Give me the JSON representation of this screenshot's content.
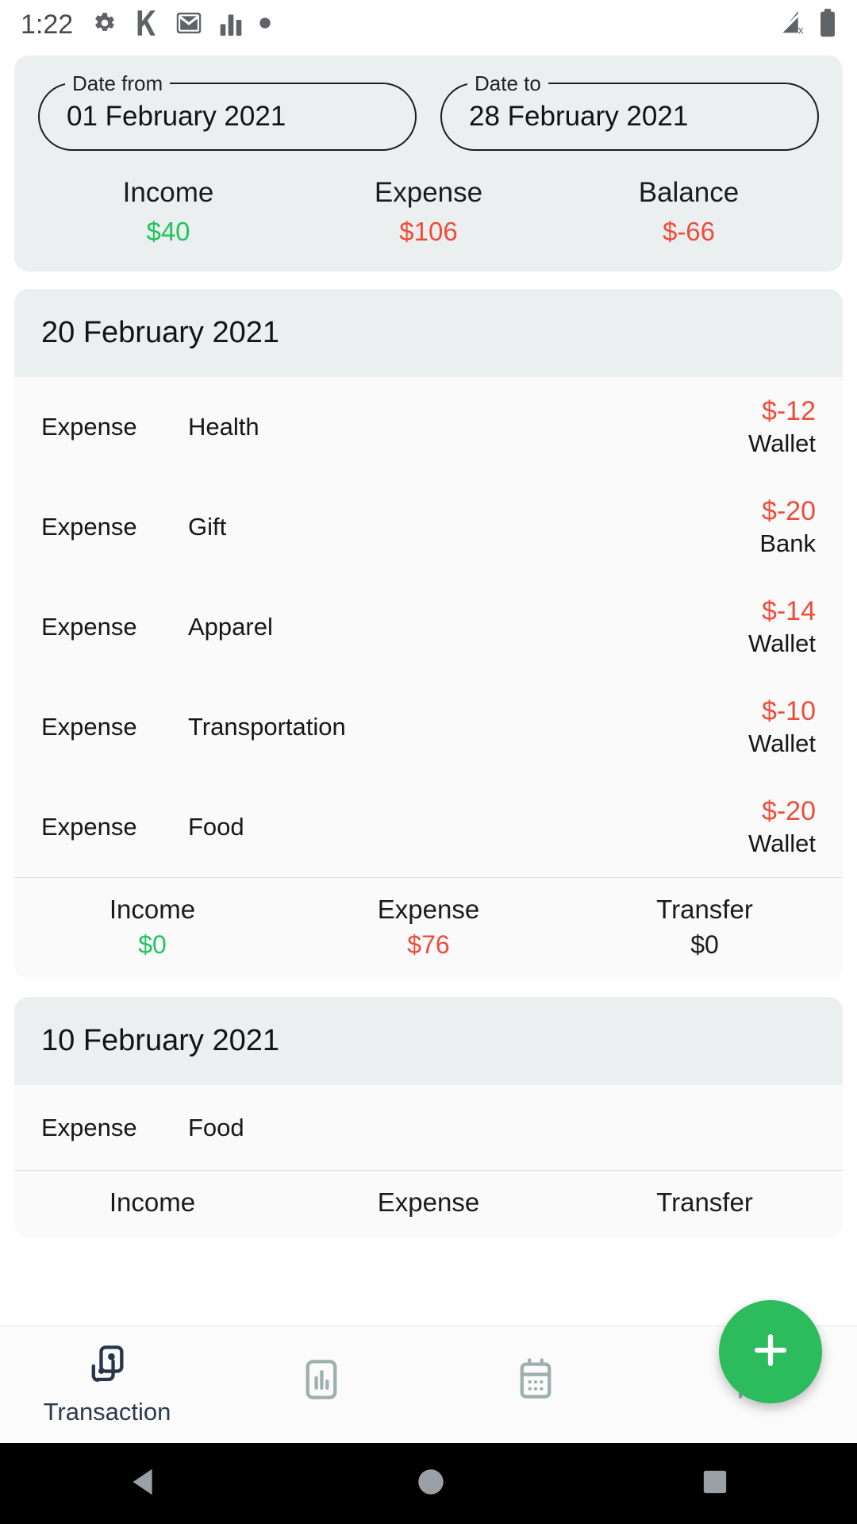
{
  "status_bar": {
    "time": "1:22",
    "left_icons": [
      "gear-icon",
      "k-app-icon",
      "gmail-icon",
      "bar-chart-icon",
      "dot-icon"
    ],
    "right_icons": [
      "signal-off-icon",
      "battery-icon"
    ]
  },
  "filter": {
    "date_from": {
      "label": "Date from",
      "value": "01 February 2021"
    },
    "date_to": {
      "label": "Date to",
      "value": "28 February 2021"
    },
    "totals": [
      {
        "label": "Income",
        "value": "$40",
        "color": "#21c45d"
      },
      {
        "label": "Expense",
        "value": "$106",
        "color": "#ef4c3a"
      },
      {
        "label": "Balance",
        "value": "$-66",
        "color": "#ef4c3a"
      }
    ]
  },
  "groups": [
    {
      "date": "20 February 2021",
      "transactions": [
        {
          "type": "Expense",
          "category": "Health",
          "amount": "$-12",
          "amount_color": "#ef4c3a",
          "account": "Wallet"
        },
        {
          "type": "Expense",
          "category": "Gift",
          "amount": "$-20",
          "amount_color": "#ef4c3a",
          "account": "Bank"
        },
        {
          "type": "Expense",
          "category": "Apparel",
          "amount": "$-14",
          "amount_color": "#ef4c3a",
          "account": "Wallet"
        },
        {
          "type": "Expense",
          "category": "Transportation",
          "amount": "$-10",
          "amount_color": "#ef4c3a",
          "account": "Wallet"
        },
        {
          "type": "Expense",
          "category": "Food",
          "amount": "$-20",
          "amount_color": "#ef4c3a",
          "account": "Wallet"
        }
      ],
      "footer": [
        {
          "label": "Income",
          "value": "$0",
          "color": "#21c45d"
        },
        {
          "label": "Expense",
          "value": "$76",
          "color": "#ef4c3a"
        },
        {
          "label": "Transfer",
          "value": "$0",
          "color": "#1b1b1b"
        }
      ]
    },
    {
      "date": "10 February 2021",
      "transactions": [
        {
          "type": "Expense",
          "category": "Food",
          "amount": "",
          "amount_color": "#ef4c3a",
          "account": ""
        }
      ],
      "footer": [
        {
          "label": "Income",
          "value": "",
          "color": "#21c45d"
        },
        {
          "label": "Expense",
          "value": "",
          "color": "#ef4c3a"
        },
        {
          "label": "Transfer",
          "value": "",
          "color": "#1b1b1b"
        }
      ]
    }
  ],
  "fab": {
    "icon": "plus-icon",
    "color": "#2cbb5d"
  },
  "bottom_nav": {
    "active_color": "#27374b",
    "inactive_color": "#9cb0ac",
    "items": [
      {
        "icon": "transaction-icon",
        "label": "Transaction",
        "active": true
      },
      {
        "icon": "statistics-icon",
        "label": "",
        "active": false
      },
      {
        "icon": "calendar-icon",
        "label": "",
        "active": false
      },
      {
        "icon": "settings-sliders-icon",
        "label": "",
        "active": false
      }
    ]
  },
  "system_nav": {
    "back": "back-triangle-icon",
    "home": "home-circle-icon",
    "recents": "recents-square-icon"
  }
}
